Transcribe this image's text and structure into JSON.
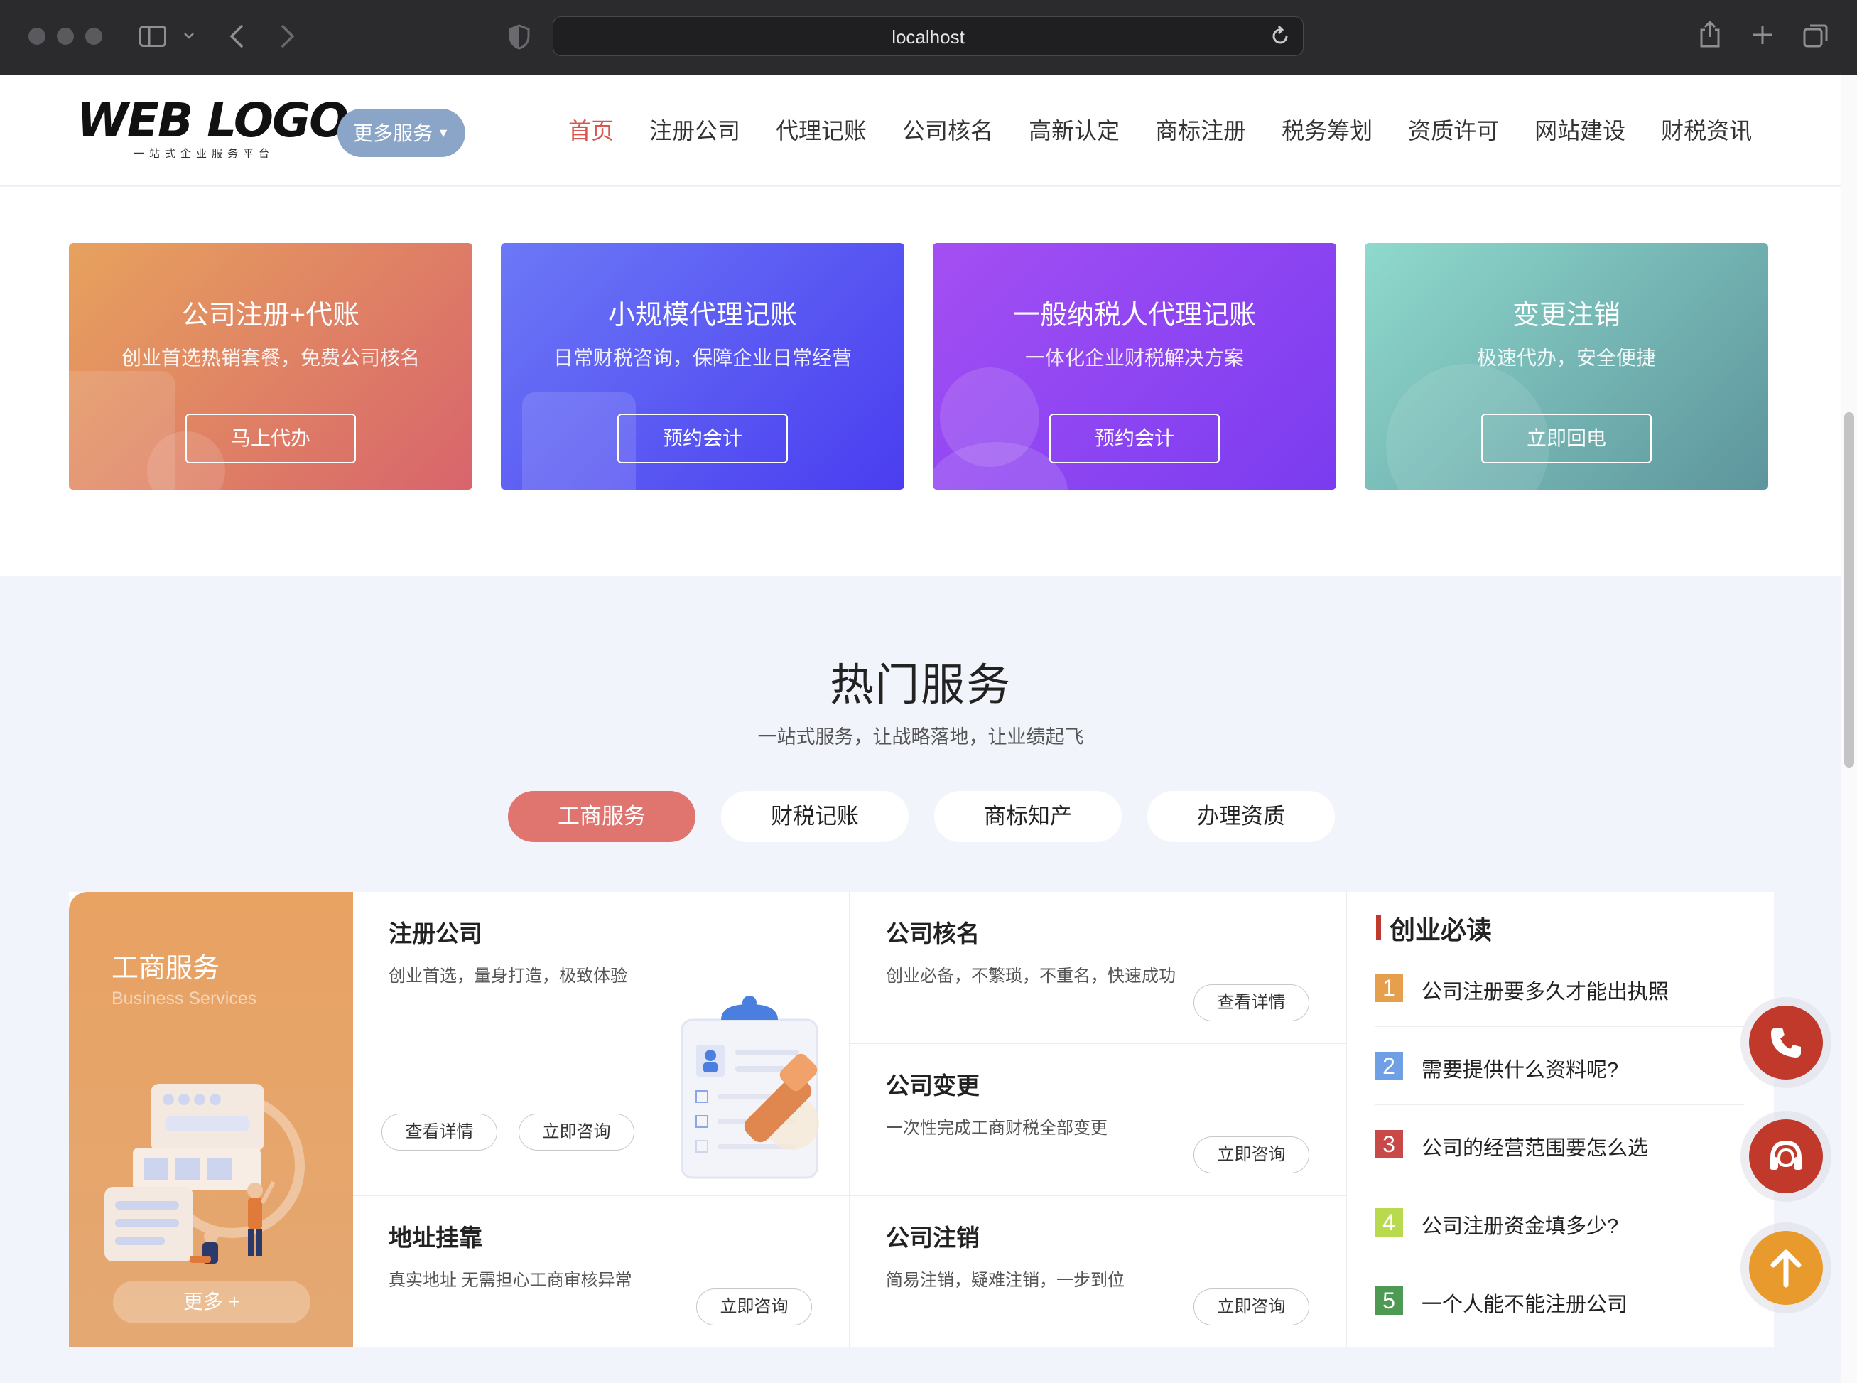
{
  "browser": {
    "url": "localhost",
    "icons": {
      "sidebar": "sidebar-icon",
      "back": "back-icon",
      "forward": "forward-icon",
      "shield": "shield-icon",
      "reload": "reload-icon",
      "share": "share-icon",
      "new_tab": "plus-icon",
      "tabs": "tabs-icon"
    }
  },
  "header": {
    "logo_text": "WEB LOGO",
    "logo_tagline": "一站式企业服务平台",
    "more_services": "更多服务",
    "nav": [
      "首页",
      "注册公司",
      "代理记账",
      "公司核名",
      "高新认定",
      "商标注册",
      "税务筹划",
      "资质许可",
      "网站建设",
      "财税资讯"
    ],
    "active_nav": "首页"
  },
  "promo_cards": [
    {
      "title": "公司注册+代账",
      "subtitle": "创业首选热销套餐，免费公司核名",
      "button": "马上代办",
      "colors": [
        "#e7a25d",
        "#d8646c"
      ]
    },
    {
      "title": "小规模代理记账",
      "subtitle": "日常财税咨询，保障企业日常经营",
      "button": "预约会计",
      "colors": [
        "#6a77f5",
        "#4b3ff0"
      ]
    },
    {
      "title": "一般纳税人代理记账",
      "subtitle": "一体化企业财税解决方案",
      "button": "预约会计",
      "colors": [
        "#a24df3",
        "#7a3cf0"
      ]
    },
    {
      "title": "变更注销",
      "subtitle": "极速代办，安全便捷",
      "button": "立即回电",
      "colors": [
        "#8ad6cb",
        "#5f9aa0"
      ]
    }
  ],
  "hot": {
    "title": "热门服务",
    "subtitle": "一站式服务，让战略落地，让业绩起飞",
    "tabs": [
      "工商服务",
      "财税记账",
      "商标知产",
      "办理资质"
    ],
    "active_tab": "工商服务"
  },
  "left_box": {
    "title": "工商服务",
    "title_en": "Business Services",
    "more": "更多 +"
  },
  "services": {
    "register": {
      "title": "注册公司",
      "desc": "创业首选，量身打造，极致体验",
      "btn1": "查看详情",
      "btn2": "立即咨询"
    },
    "name_check": {
      "title": "公司核名",
      "desc": "创业必备，不繁琐，不重名，快速成功",
      "btn": "查看详情"
    },
    "change": {
      "title": "公司变更",
      "desc": "一次性完成工商财税全部变更",
      "btn": "立即咨询"
    },
    "address": {
      "title": "地址挂靠",
      "desc": "真实地址 无需担心工商审核异常",
      "btn": "立即咨询"
    },
    "cancel": {
      "title": "公司注销",
      "desc": "简易注销，疑难注销，一步到位",
      "btn": "立即咨询"
    }
  },
  "faq": {
    "title": "创业必读",
    "items": [
      {
        "num": "1",
        "q": "公司注册要多久才能出执照",
        "color": "#e6a04d"
      },
      {
        "num": "2",
        "q": "需要提供什么资料呢?",
        "color": "#6fa0e6"
      },
      {
        "num": "3",
        "q": "公司的经营范围要怎么选",
        "color": "#c94848"
      },
      {
        "num": "4",
        "q": "公司注册资金填多少?",
        "color": "#b9d94f"
      },
      {
        "num": "5",
        "q": "一个人能不能注册公司",
        "color": "#4e9a55"
      }
    ]
  },
  "float_buttons": {
    "phone": "phone-icon",
    "support": "headset-icon",
    "top": "arrow-up-icon"
  }
}
